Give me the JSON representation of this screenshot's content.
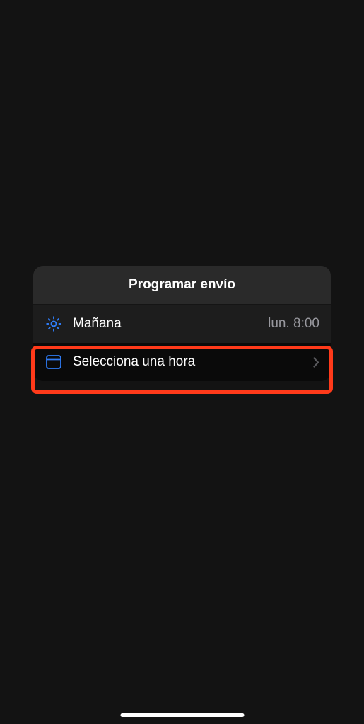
{
  "sheet": {
    "title": "Programar envío",
    "options": [
      {
        "icon": "sun-icon",
        "label": "Mañana",
        "detail": "lun. 8:00"
      },
      {
        "icon": "calendar-icon",
        "label": "Selecciona una hora"
      }
    ]
  },
  "colors": {
    "accent_blue": "#2f7cf6",
    "highlight": "#ff3a1a"
  }
}
